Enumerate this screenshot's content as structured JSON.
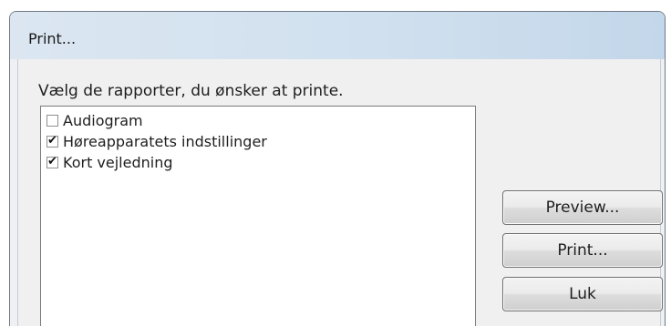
{
  "window": {
    "title": "Print..."
  },
  "instruction": "Vælg de rapporter, du ønsker at printe.",
  "reports": [
    {
      "label": "Audiogram",
      "checked": false
    },
    {
      "label": "Høreapparatets indstillinger",
      "checked": true
    },
    {
      "label": "Kort vejledning",
      "checked": true
    }
  ],
  "buttons": {
    "preview": "Preview...",
    "print": "Print...",
    "close": "Luk"
  }
}
